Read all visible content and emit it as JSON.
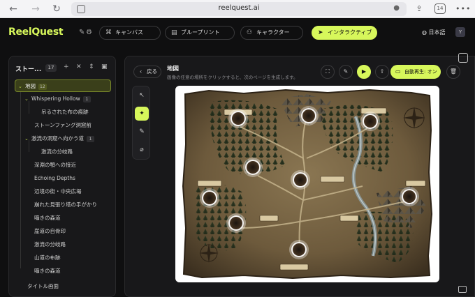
{
  "browser": {
    "url": "reelquest.ai",
    "tab_count": "14",
    "more": "•••"
  },
  "header": {
    "logo": "ReelQuest",
    "tabs": [
      {
        "label": "キャンバス",
        "icon": "canvas-icon"
      },
      {
        "label": "ブループリント",
        "icon": "blueprint-icon"
      },
      {
        "label": "キャラクター",
        "icon": "characters-icon"
      },
      {
        "label": "インタラクティブ",
        "icon": "interactive-icon"
      }
    ],
    "language": "日本語",
    "avatar": "Y"
  },
  "left_panel": {
    "title": "ストー...",
    "count": "17",
    "items": [
      {
        "label": "地図",
        "badge": "12"
      },
      {
        "label": "Whispering Hollow",
        "badge": "1"
      },
      {
        "label": "吊るされた布の痕跡"
      },
      {
        "label": "ストーンファング洞窟前"
      },
      {
        "label": "激流の洞窟へ向かう道",
        "badge": "1"
      },
      {
        "label": "激流の分岐路"
      },
      {
        "label": "深淵の顎への接近"
      },
      {
        "label": "Echoing Depths"
      },
      {
        "label": "辺境の街・中央広場"
      },
      {
        "label": "崩れた見張り塔の手がかり"
      },
      {
        "label": "囁きの森道"
      },
      {
        "label": "崖道の自骨印"
      },
      {
        "label": "激流の分岐路"
      },
      {
        "label": "山道の布跡"
      },
      {
        "label": "囁きの森道"
      },
      {
        "label": "タイトル画面"
      }
    ]
  },
  "main": {
    "back_label": "戻る",
    "title": "地図",
    "subtitle": "画像の任意の場所をクリックすると、次のページを生成します。",
    "autoplay_label": "自動再生: オン"
  }
}
